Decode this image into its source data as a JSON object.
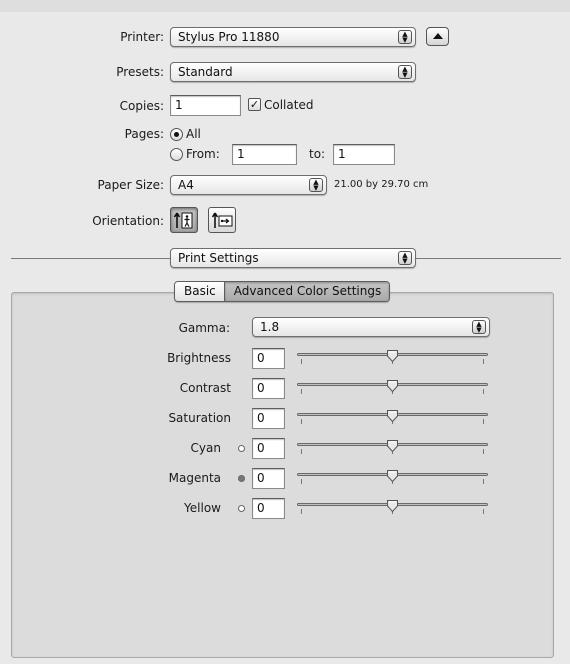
{
  "printer": {
    "label": "Printer:",
    "value": "Stylus Pro 11880",
    "disclosure_icon": "triangle-up-icon"
  },
  "presets": {
    "label": "Presets:",
    "value": "Standard"
  },
  "copies": {
    "label": "Copies:",
    "value": "1",
    "collated_label": "Collated",
    "collated_checked": true
  },
  "pages": {
    "label": "Pages:",
    "all_label": "All",
    "from_label": "From:",
    "from_value": "1",
    "to_label": "to:",
    "to_value": "1"
  },
  "paper_size": {
    "label": "Paper Size:",
    "value": "A4",
    "dimensions": "21.00 by 29.70 cm"
  },
  "orientation": {
    "label": "Orientation:",
    "options": [
      "portrait",
      "landscape"
    ],
    "selected": "portrait"
  },
  "section_popup": {
    "value": "Print Settings"
  },
  "tabs": [
    {
      "label": "Basic",
      "selected": false
    },
    {
      "label": "Advanced Color Settings",
      "selected": true
    }
  ],
  "gamma": {
    "label": "Gamma:",
    "value": "1.8"
  },
  "adjustments": [
    {
      "label": "Brightness",
      "value": "0",
      "swatch": null
    },
    {
      "label": "Contrast",
      "value": "0",
      "swatch": null
    },
    {
      "label": "Saturation",
      "value": "0",
      "swatch": null
    },
    {
      "label": "Cyan",
      "value": "0",
      "swatch": "hollow"
    },
    {
      "label": "Magenta",
      "value": "0",
      "swatch": "filled"
    },
    {
      "label": "Yellow",
      "value": "0",
      "swatch": "hollow"
    }
  ]
}
